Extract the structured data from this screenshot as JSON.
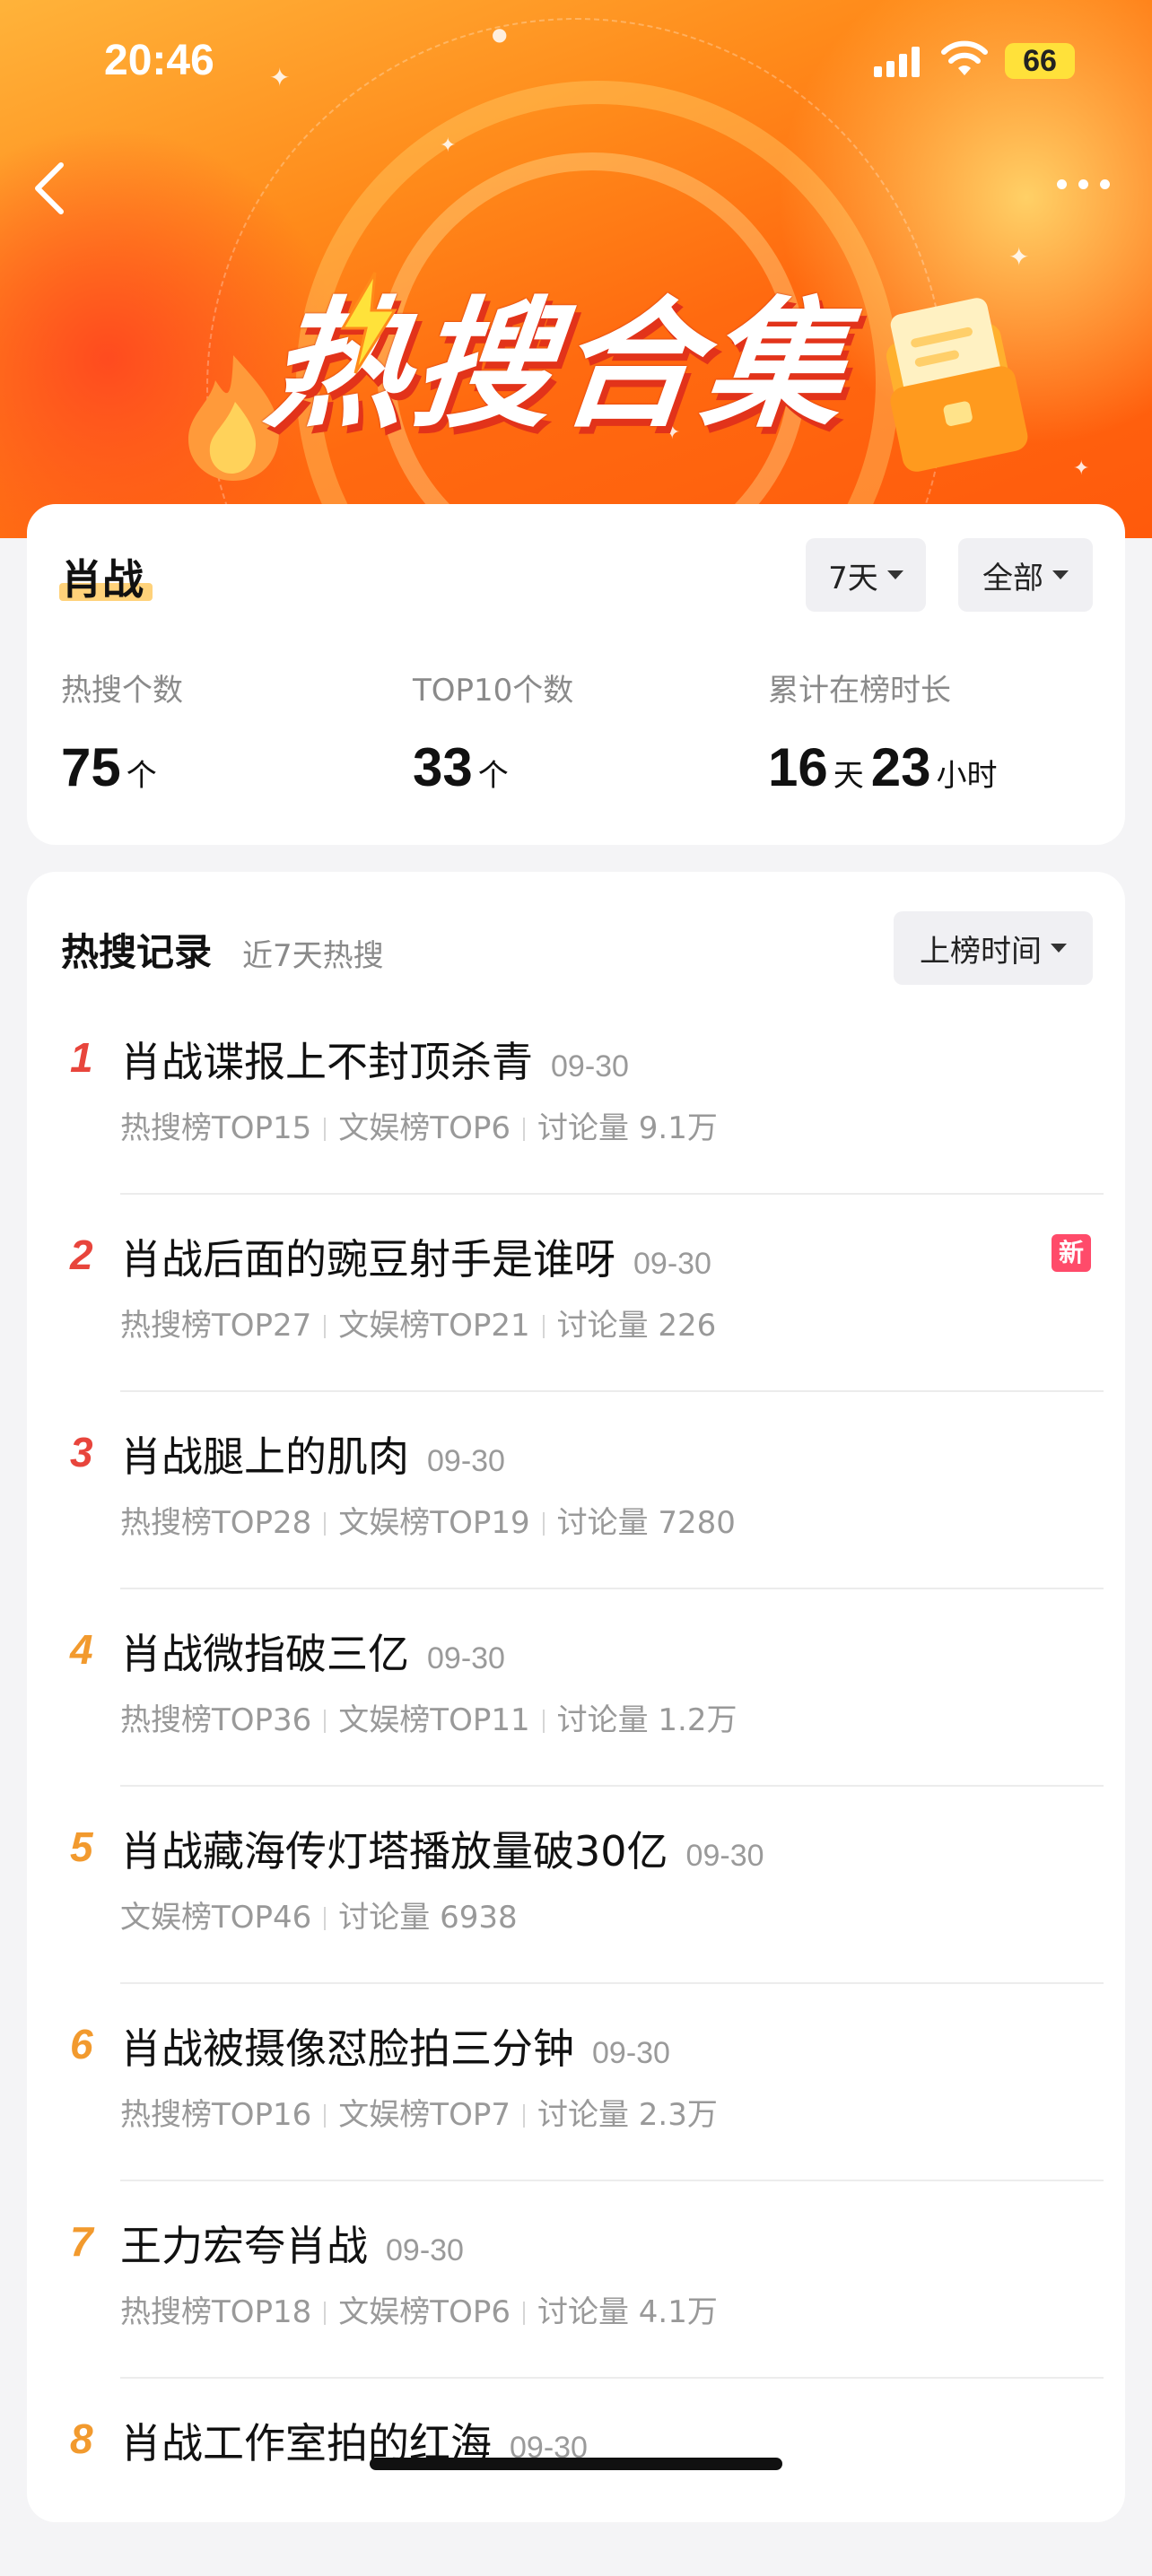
{
  "status_bar": {
    "time": "20:46",
    "battery": "66"
  },
  "hero": {
    "title": "热搜合集"
  },
  "summary": {
    "name": "肖战",
    "days_filter": "7天",
    "scope_filter": "全部",
    "stats": [
      {
        "label": "热搜个数",
        "value": "75",
        "unit": "个"
      },
      {
        "label": "TOP10个数",
        "value": "33",
        "unit": "个"
      },
      {
        "label": "累计在榜时长",
        "value": "16",
        "unit": "天",
        "value2": "23",
        "unit2": "小时"
      }
    ]
  },
  "records": {
    "title": "热搜记录",
    "subtitle": "近7天热搜",
    "sort_label": "上榜时间",
    "new_badge": "新",
    "items": [
      {
        "rank": "1",
        "title": "肖战谍报上不封顶杀青",
        "date": "09-30",
        "meta": [
          "热搜榜TOP15",
          "文娱榜TOP6",
          "讨论量 9.1万"
        ],
        "rank_color": "#e8453c"
      },
      {
        "rank": "2",
        "title": "肖战后面的豌豆射手是谁呀",
        "date": "09-30",
        "meta": [
          "热搜榜TOP27",
          "文娱榜TOP21",
          "讨论量 226"
        ],
        "rank_color": "#e8453c",
        "is_new": true
      },
      {
        "rank": "3",
        "title": "肖战腿上的肌肉",
        "date": "09-30",
        "meta": [
          "热搜榜TOP28",
          "文娱榜TOP19",
          "讨论量 7280"
        ],
        "rank_color": "#e8453c"
      },
      {
        "rank": "4",
        "title": "肖战微指破三亿",
        "date": "09-30",
        "meta": [
          "热搜榜TOP36",
          "文娱榜TOP11",
          "讨论量 1.2万"
        ],
        "rank_color": "#f29a2e"
      },
      {
        "rank": "5",
        "title": "肖战藏海传灯塔播放量破30亿",
        "date": "09-30",
        "meta": [
          "文娱榜TOP46",
          "讨论量 6938"
        ],
        "rank_color": "#f29a2e"
      },
      {
        "rank": "6",
        "title": "肖战被摄像怼脸拍三分钟",
        "date": "09-30",
        "meta": [
          "热搜榜TOP16",
          "文娱榜TOP7",
          "讨论量 2.3万"
        ],
        "rank_color": "#f29a2e"
      },
      {
        "rank": "7",
        "title": "王力宏夸肖战",
        "date": "09-30",
        "meta": [
          "热搜榜TOP18",
          "文娱榜TOP6",
          "讨论量 4.1万"
        ],
        "rank_color": "#f29a2e"
      },
      {
        "rank": "8",
        "title": "肖战工作室拍的红海",
        "date": "09-30",
        "meta": [],
        "rank_color": "#f29a2e"
      }
    ]
  }
}
